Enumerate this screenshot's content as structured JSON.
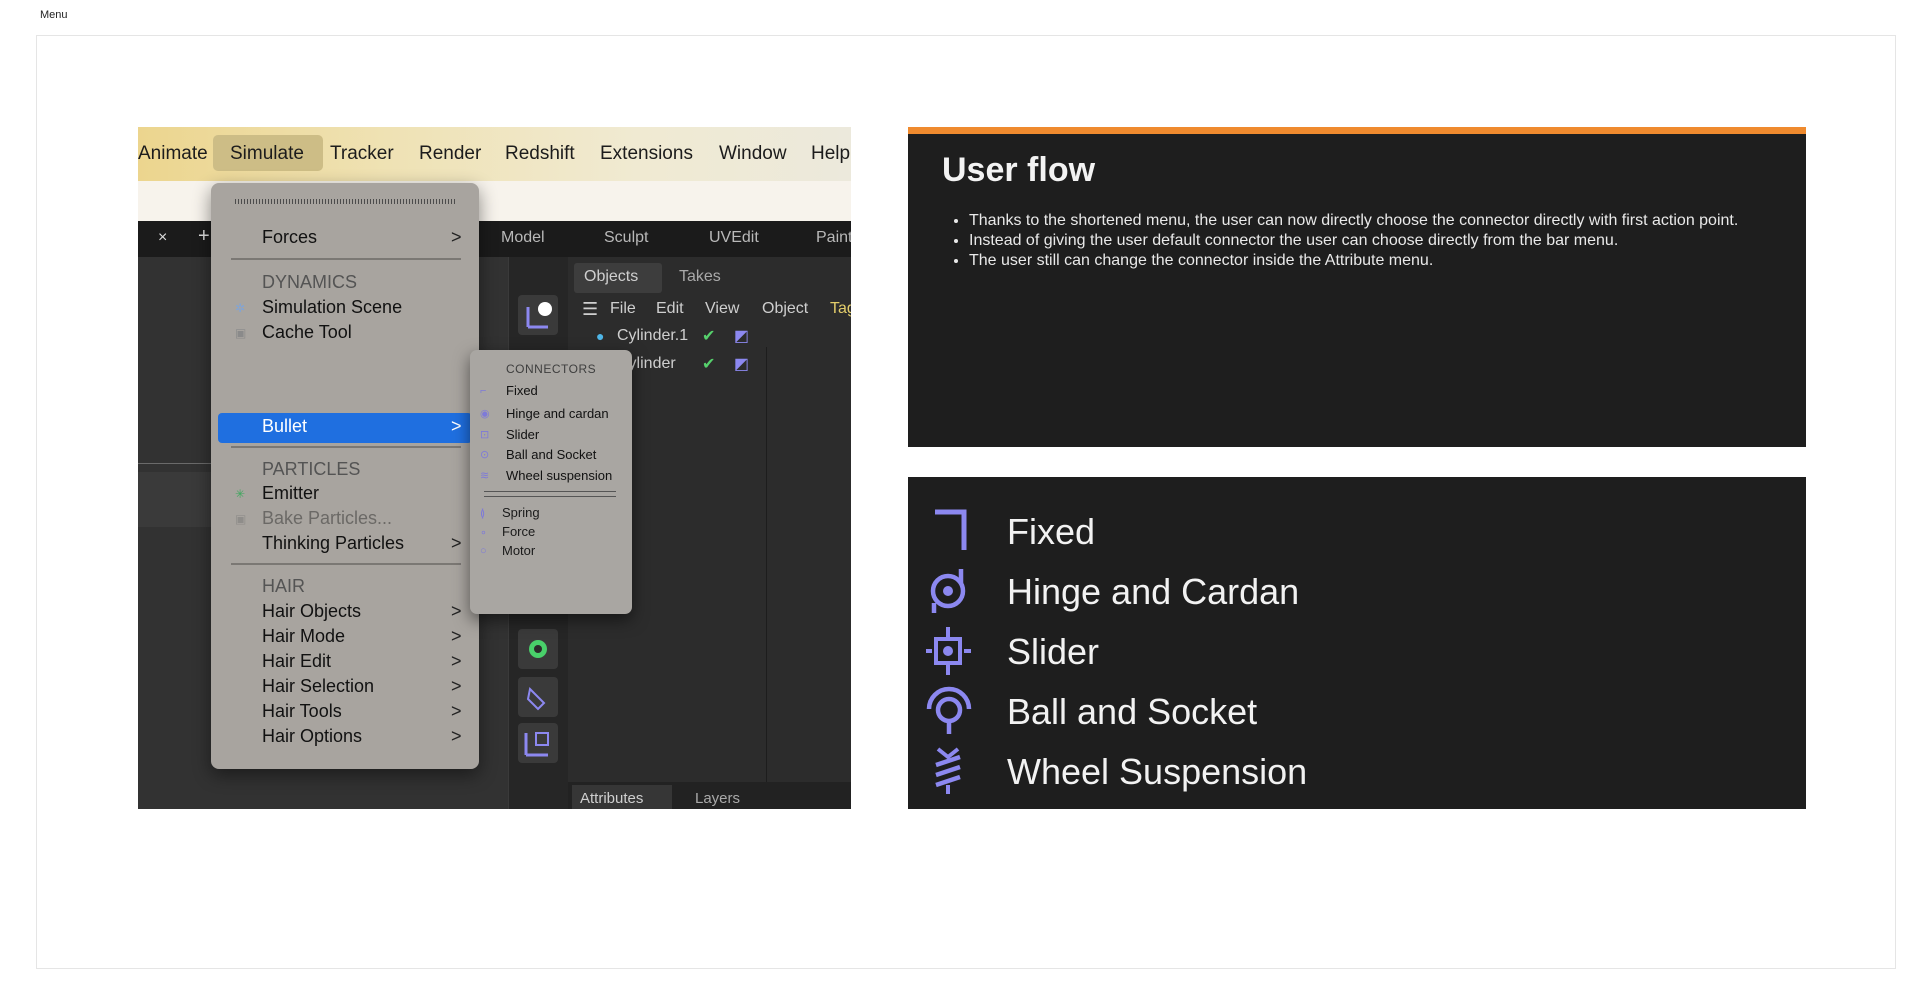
{
  "frame_label": "Menu",
  "menubar": {
    "items": [
      "Animate",
      "Simulate",
      "Tracker",
      "Render",
      "Redshift",
      "Extensions",
      "Window",
      "Help"
    ]
  },
  "tabbar": {
    "close": "×",
    "add": "+",
    "modes": [
      "Model",
      "Sculpt",
      "UVEdit",
      "Paint"
    ]
  },
  "object_panel": {
    "tabs": [
      "Objects",
      "Takes"
    ],
    "menu": [
      "File",
      "Edit",
      "View",
      "Object",
      "Tags"
    ],
    "rows": [
      "Cylinder.1",
      "Cylinder"
    ],
    "bottom_tabs": [
      "Attributes",
      "Layers"
    ]
  },
  "dropdown": {
    "forces": "Forces",
    "dynamics_header": "DYNAMICS",
    "simulation_scene": "Simulation Scene",
    "cache_tool": "Cache Tool",
    "bullet": "Bullet",
    "particles_header": "PARTICLES",
    "emitter": "Emitter",
    "bake_particles": "Bake Particles...",
    "thinking_particles": "Thinking Particles",
    "hair_header": "HAIR",
    "hair_items": [
      "Hair Objects",
      "Hair Mode",
      "Hair Edit",
      "Hair Selection",
      "Hair Tools",
      "Hair Options"
    ],
    "chevron": ">"
  },
  "submenu": {
    "header": "CONNECTORS",
    "connectors": [
      "Fixed",
      "Hinge and cardan",
      "Slider",
      "Ball and Socket",
      "Wheel suspension"
    ],
    "others": [
      "Spring",
      "Force",
      "Motor"
    ]
  },
  "user_flow": {
    "title": "User flow",
    "bullets": [
      "Thanks to the shortened menu, the user can now directly choose the connector directly with first action point.",
      "Instead of giving the user default connector the user can choose directly from the bar menu.",
      "The user still can change the connector inside the Attribute menu."
    ]
  },
  "legend": {
    "items": [
      {
        "label": "Fixed",
        "icon": "fixed-icon"
      },
      {
        "label": "Hinge and Cardan",
        "icon": "hinge-icon"
      },
      {
        "label": "Slider",
        "icon": "slider-icon"
      },
      {
        "label": "Ball and Socket",
        "icon": "ball-socket-icon"
      },
      {
        "label": "Wheel Suspension",
        "icon": "wheel-suspension-icon"
      }
    ]
  },
  "colors": {
    "accent_orange": "#ef8a2e",
    "icon_purple": "#8c88f0",
    "highlight_blue": "#1f6fe0"
  }
}
